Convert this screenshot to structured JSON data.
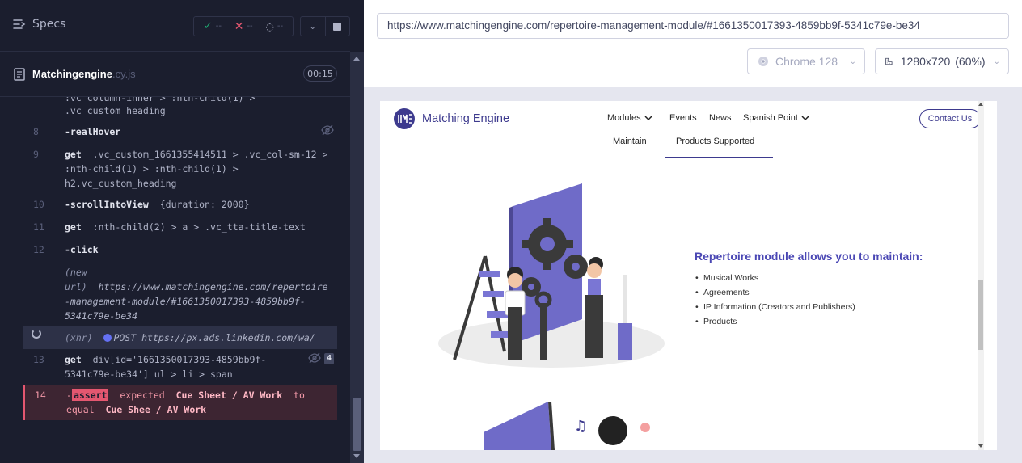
{
  "specs": {
    "title": "Specs",
    "passed": "--",
    "failed": "--",
    "pending": "--"
  },
  "file": {
    "name": "Matchingengine",
    "ext": ".cy.js",
    "timer": "00:15"
  },
  "commands": {
    "partial_line_1": ":vc_column-inner > :nth-child(1) >",
    "partial_line_2": ".vc_custom_heading",
    "c8": {
      "num": "8",
      "name": "-realHover"
    },
    "c9": {
      "num": "9",
      "name": "get",
      "arg1": ".vc_custom_1661355414511 > .vc_col-sm-12 >",
      "arg2": ":nth-child(1) > :nth-child(1) >",
      "arg3": "h2.vc_custom_heading"
    },
    "c10": {
      "num": "10",
      "name": "-scrollIntoView",
      "arg": "{duration: 2000}"
    },
    "c11": {
      "num": "11",
      "name": "get",
      "arg": ":nth-child(2) > a > .vc_tta-title-text"
    },
    "c12": {
      "num": "12",
      "name": "-click"
    },
    "newurl": {
      "label1": "(new",
      "label2": "url)",
      "url1": "https://www.matchingengine.com/repertoire",
      "url2": "-management-module/#1661350017393-4859bb9f-",
      "url3": "5341c79e-be34"
    },
    "xhr": {
      "label": "(xhr)",
      "method": "POST",
      "url": "https://px.ads.linkedin.com/wa/"
    },
    "c13": {
      "num": "13",
      "name": "get",
      "arg1": "div[id='1661350017393-4859bb9f-",
      "arg2": "5341c79e-be34'] ul > li > span",
      "badge": "4"
    },
    "c14": {
      "num": "14",
      "tag": "assert",
      "w1": "expected",
      "v1": "Cue Sheet / AV Work",
      "w2": "to",
      "w3": "equal",
      "v2": "Cue Shee / AV Work"
    }
  },
  "browser": {
    "url": "https://www.matchingengine.com/repertoire-management-module/#1661350017393-4859bb9f-5341c79e-be34",
    "name": "Chrome 128",
    "viewport": "1280x720",
    "zoom": "(60%)"
  },
  "aut": {
    "brand": "Matching Engine",
    "nav": {
      "modules": "Modules",
      "events": "Events",
      "news": "News",
      "spanish_point": "Spanish Point"
    },
    "contact": "Contact Us",
    "tabs": {
      "maintain": "Maintain",
      "products": "Products Supported"
    },
    "heading": "Repertoire module allows you to maintain:",
    "items": [
      "Musical Works",
      "Agreements",
      "IP Information (Creators and Publishers)",
      "Products"
    ]
  },
  "colors": {
    "runner_bg": "#1b1e2e",
    "brand_purple": "#4a47b4",
    "assert_red": "#e45770",
    "pass_green": "#1fa971",
    "illustration_purple": "#6f6bc8"
  }
}
